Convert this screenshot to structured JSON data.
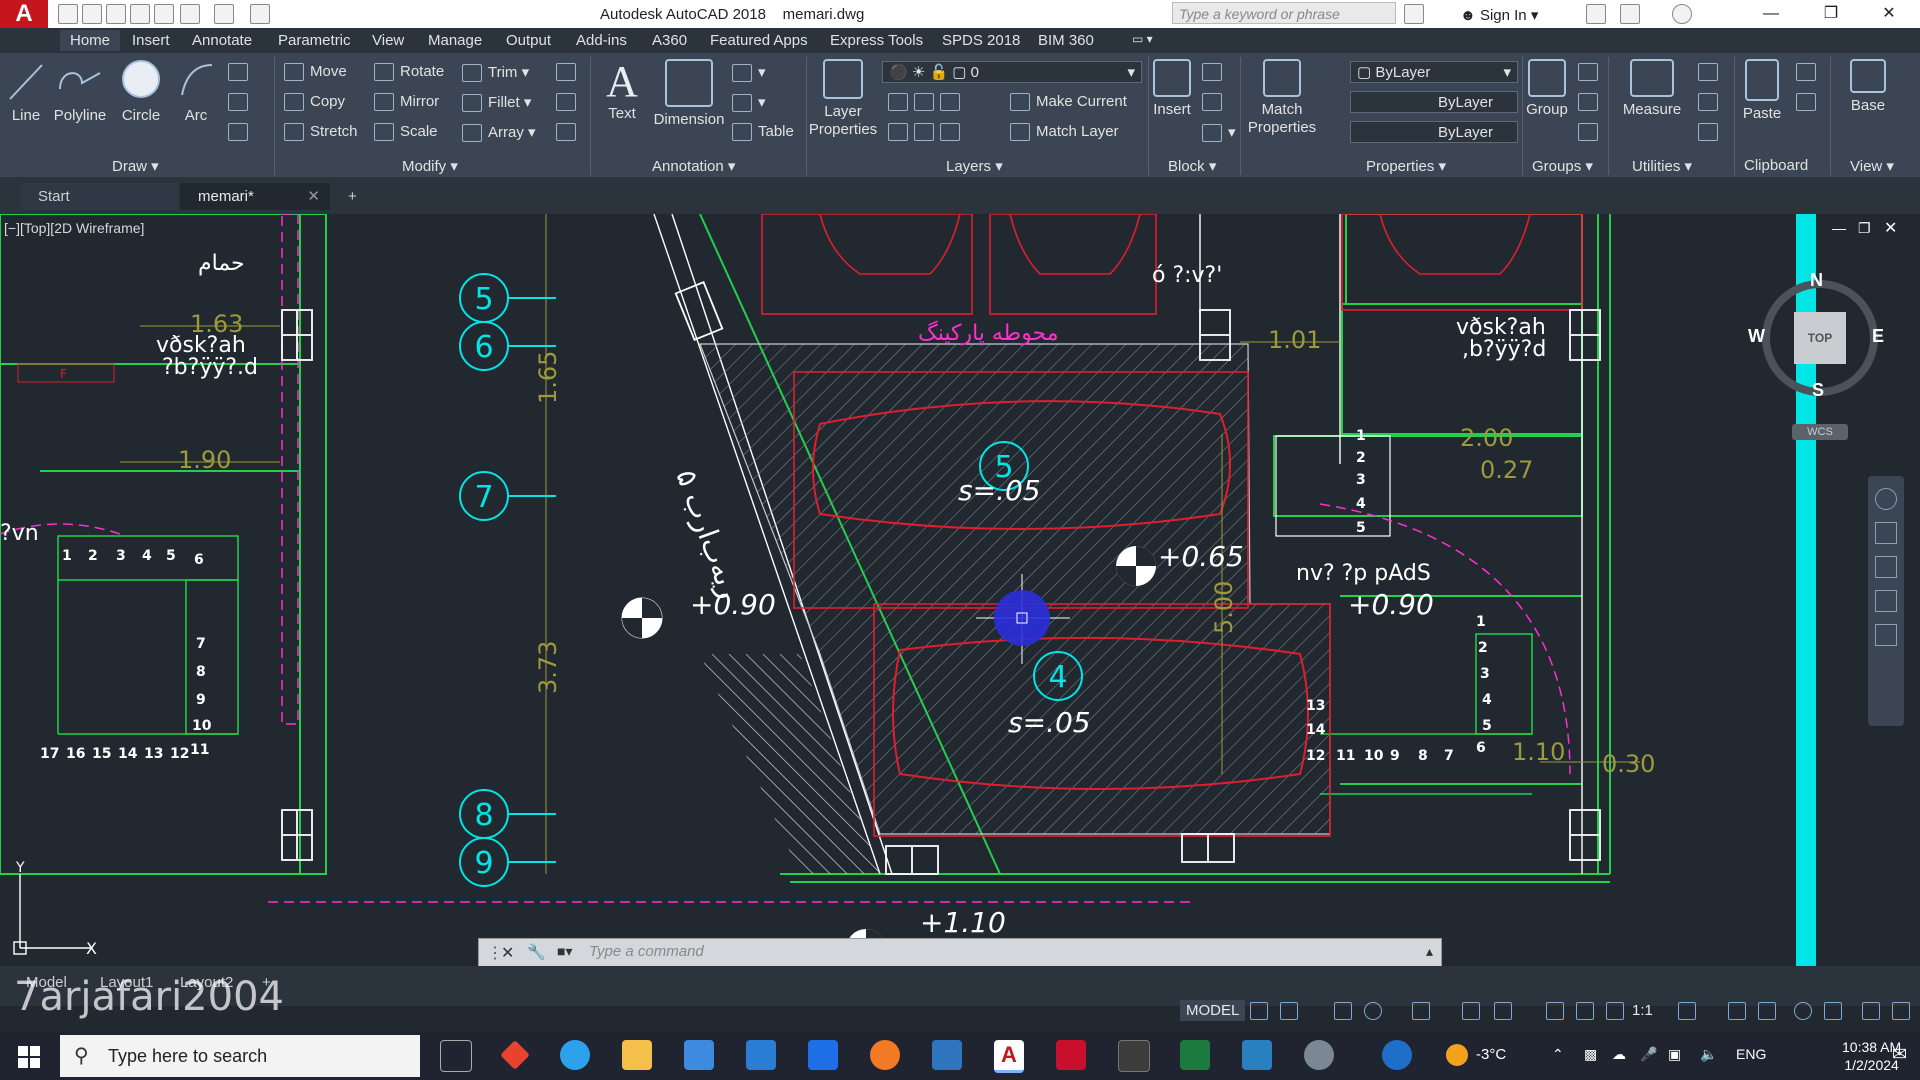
{
  "titlebar": {
    "app_title": "Autodesk AutoCAD 2018",
    "file_name": "memari.dwg",
    "search_placeholder": "Type a keyword or phrase",
    "sign_in": "Sign In"
  },
  "menu": {
    "tabs": [
      "Home",
      "Insert",
      "Annotate",
      "Parametric",
      "View",
      "Manage",
      "Output",
      "Add-ins",
      "A360",
      "Featured Apps",
      "Express Tools",
      "SPDS 2018",
      "BIM 360"
    ]
  },
  "ribbon": {
    "draw": {
      "title": "Draw",
      "line": "Line",
      "polyline": "Polyline",
      "circle": "Circle",
      "arc": "Arc"
    },
    "modify": {
      "title": "Modify",
      "move": "Move",
      "rotate": "Rotate",
      "trim": "Trim",
      "copy": "Copy",
      "mirror": "Mirror",
      "fillet": "Fillet",
      "stretch": "Stretch",
      "scale": "Scale",
      "array": "Array"
    },
    "annotation": {
      "title": "Annotation",
      "text": "Text",
      "dimension": "Dimension",
      "table": "Table"
    },
    "layers": {
      "title": "Layers",
      "layer_properties": "Layer Properties",
      "current_layer": "0",
      "make_current": "Make Current",
      "match_layer": "Match Layer"
    },
    "block": {
      "title": "Block",
      "insert": "Insert"
    },
    "properties": {
      "title": "Properties",
      "match_properties": "Match Properties",
      "color": "ByLayer",
      "linetype": "ByLayer",
      "lineweight": "ByLayer"
    },
    "groups": {
      "title": "Groups",
      "group": "Group"
    },
    "utilities": {
      "title": "Utilities",
      "measure": "Measure"
    },
    "clipboard": {
      "title": "Clipboard",
      "paste": "Paste"
    },
    "view": {
      "title": "View",
      "base": "Base"
    }
  },
  "doc_tabs": {
    "start": "Start",
    "memari": "memari*"
  },
  "viewport": {
    "label": "[−][Top][2D Wireframe]",
    "viewcube": {
      "n": "N",
      "s": "S",
      "e": "E",
      "w": "W",
      "top": "TOP",
      "wcs": "WCS"
    }
  },
  "drawing": {
    "labels": {
      "hamam": "حمام",
      "parking": "محوطه پارکینگ",
      "circle5": "5",
      "circle6": "6",
      "circle7": "7",
      "circle8": "8",
      "circle9": "9",
      "car5": "5",
      "car4": "4",
      "slope1": "s=.05",
      "slope2": "s=.05",
      "elev_065": "+0.65",
      "elev_090_left": "+0.90",
      "elev_090_right": "+0.90",
      "elev_110": "+1.10",
      "dim_163": "1.63",
      "dim_190": "1.90",
      "dim_101": "1.01",
      "dim_200": "2.00",
      "dim_027": "0.27",
      "dim_165": "1.65",
      "dim_373": "3.73",
      "dim_030": "0.30",
      "dim_110v": "1.10",
      "dim_500": "5.00",
      "garbled1": "vðsk?ah",
      "garbled2": "?b?ÿÿ?.d",
      "garbled3": "vðsk?ah",
      "garbled4": ",b?ÿÿ?d",
      "garbled5": "nv? ?p pAdS",
      "garbled6": "ó ?:v?'",
      "handwriting": "ریه‌ب‌ار‌ب ‌۵",
      "f_tag": "F"
    },
    "stairs_left_top": [
      "1",
      "2",
      "3",
      "4",
      "5",
      "6"
    ],
    "stairs_left_side": [
      "7",
      "8",
      "9",
      "10",
      "11"
    ],
    "stairs_left_bottom": [
      "17",
      "16",
      "15",
      "14",
      "13",
      "12"
    ],
    "stairs_mid": [
      "1",
      "2",
      "3",
      "4",
      "5"
    ],
    "stairs_right_side": [
      "1",
      "2",
      "3",
      "4",
      "5",
      "6"
    ],
    "stairs_right_bottom": [
      "12",
      "11",
      "10",
      "9",
      "8",
      "7",
      "13",
      "14"
    ]
  },
  "command": {
    "placeholder": "Type a command"
  },
  "layout_tabs": {
    "model": "Model",
    "layout1": "Layout1",
    "layout2": "Layout2"
  },
  "watermark": "7arjafari2004",
  "status": {
    "model": "MODEL",
    "scale": "1:1"
  },
  "taskbar": {
    "search_placeholder": "Type here to search",
    "temperature": "-3°C",
    "language": "ENG",
    "time": "10:38 AM",
    "date": "1/2/2024"
  },
  "colors": {
    "accent": "#c4161c",
    "drawing_bg": "#212830",
    "cyan": "#00e5e5",
    "red": "#e01e2e",
    "green": "#22d04a",
    "magenta": "#ff2fd0"
  }
}
